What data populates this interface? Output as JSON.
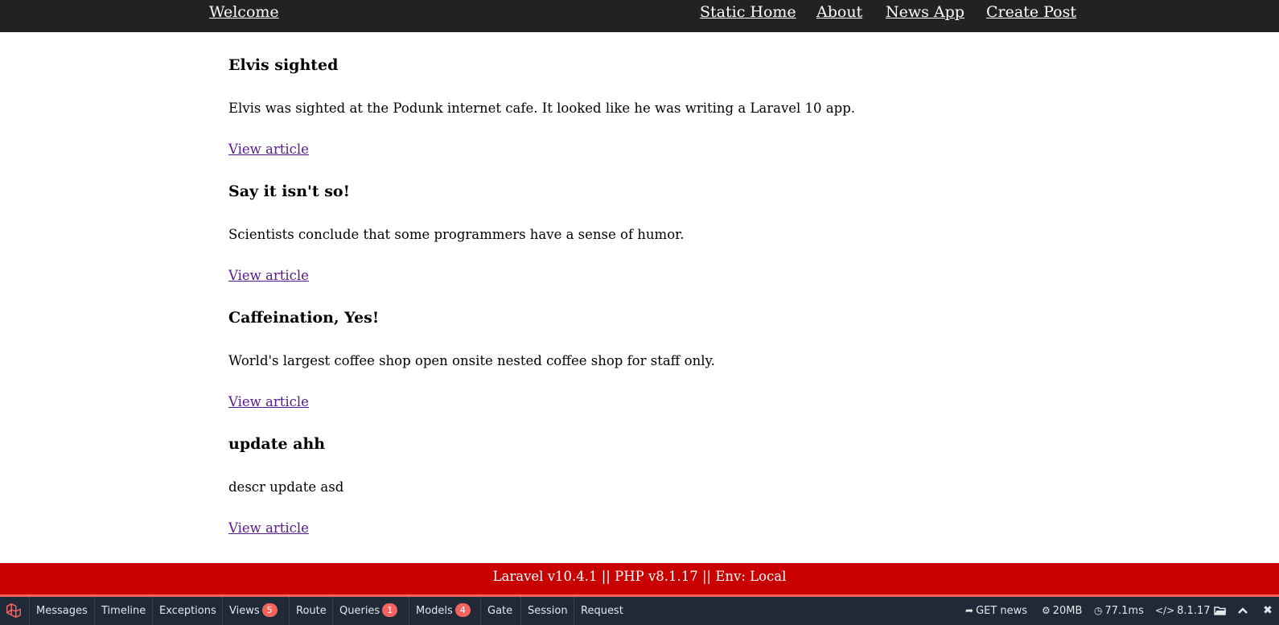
{
  "nav": {
    "brand": "Welcome",
    "links": [
      "Static Home",
      "About",
      "News App",
      "Create Post"
    ]
  },
  "articles": [
    {
      "title": "Elvis sighted",
      "body": "Elvis was sighted at the Podunk internet cafe. It looked like he was writing a Laravel 10 app.",
      "link": "View article"
    },
    {
      "title": "Say it isn't so!",
      "body": "Scientists conclude that some programmers have a sense of humor.",
      "link": "View article"
    },
    {
      "title": "Caffeination, Yes!",
      "body": "World's largest coffee shop open onsite nested coffee shop for staff only.",
      "link": "View article"
    },
    {
      "title": "update ahh",
      "body": "descr update asd",
      "link": "View article"
    }
  ],
  "footer": {
    "text": "Laravel v10.4.1 || PHP v8.1.17 || Env: Local"
  },
  "debugbar": {
    "logo_icon": "laravel-logo-icon",
    "tabs": [
      {
        "label": "Messages",
        "badge": ""
      },
      {
        "label": "Timeline",
        "badge": ""
      },
      {
        "label": "Exceptions",
        "badge": ""
      },
      {
        "label": "Views",
        "badge": "5"
      },
      {
        "label": "Route",
        "badge": ""
      },
      {
        "label": "Queries",
        "badge": "1"
      },
      {
        "label": "Models",
        "badge": "4"
      },
      {
        "label": "Gate",
        "badge": ""
      },
      {
        "label": "Session",
        "badge": ""
      },
      {
        "label": "Request",
        "badge": ""
      }
    ],
    "request": "GET news",
    "memory": "20MB",
    "duration": "77.1ms",
    "php_version": "8.1.17",
    "accent_color": "#f4645f"
  },
  "colors": {
    "nav_bg": "#222222",
    "footer_bg": "#c90000",
    "link_visited": "#551a8b"
  }
}
